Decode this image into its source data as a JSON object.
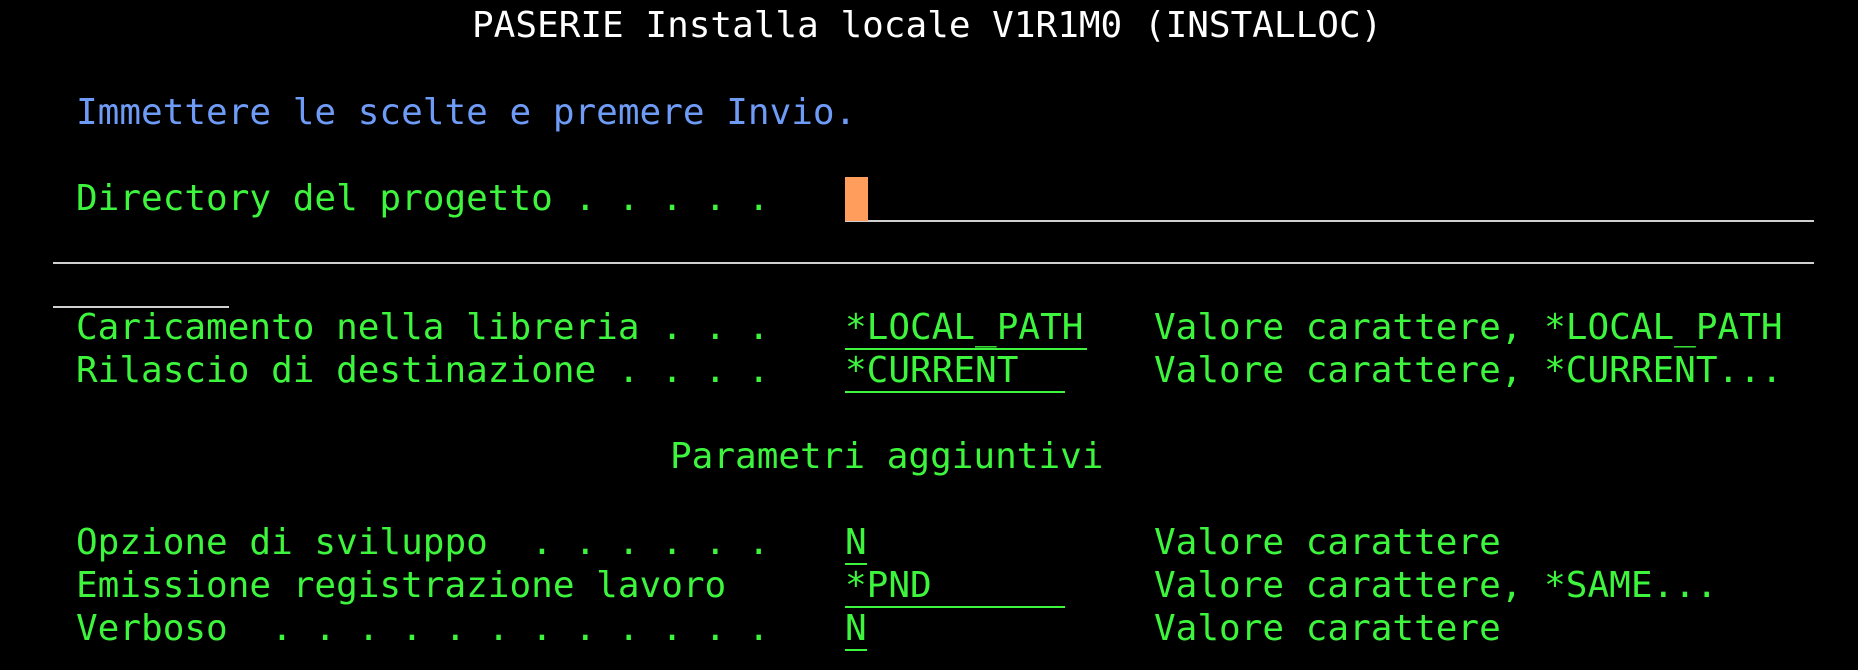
{
  "screen": {
    "title": "PASERIE Installa locale V1R1M0 (INSTALLOC)",
    "instruction": "Immettere le scelte e premere Invio.",
    "section_additional": "Parametri aggiuntivi"
  },
  "fields": {
    "project_dir": {
      "label": "Directory del progetto . . . . .",
      "value": ""
    },
    "library": {
      "label": "Caricamento nella libreria . . .",
      "value": "*LOCAL_PATH",
      "hint": "Valore carattere, *LOCAL_PATH"
    },
    "release": {
      "label": "Rilascio di destinazione . . . .",
      "value": "*CURRENT",
      "hint": "Valore carattere, *CURRENT..."
    },
    "dev_option": {
      "label": "Opzione di sviluppo  . . . . . .",
      "value": "N",
      "hint": "Valore carattere"
    },
    "job_log": {
      "label": "Emissione registrazione lavoro",
      "value": "*PND",
      "hint": "Valore carattere, *SAME..."
    },
    "verbose": {
      "label": "Verboso  . . . . . . . . . . . .",
      "value": "N",
      "hint": "Valore carattere"
    }
  },
  "colors": {
    "background": "#000000",
    "title": "#ffffff",
    "instruction": "#6e9bf5",
    "field_text": "#3df53d",
    "cursor": "#ff9d5c",
    "rule": "#d0d0d0"
  }
}
